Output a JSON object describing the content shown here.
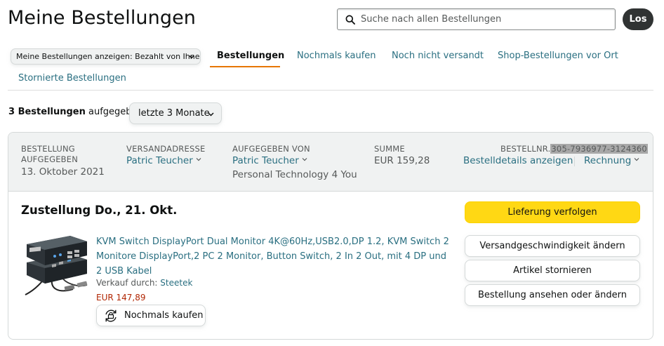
{
  "page": {
    "title": "Meine Bestellungen"
  },
  "search": {
    "placeholder": "Suche nach allen Bestellungen",
    "value": "",
    "button_label": "Los"
  },
  "filter": {
    "selected": "Meine Bestellungen anzeigen: Bezahlt von Ihnen"
  },
  "tabs": [
    {
      "label": "Bestellungen",
      "active": true
    },
    {
      "label": "Nochmals kaufen",
      "active": false
    },
    {
      "label": "Noch nicht versandt",
      "active": false
    },
    {
      "label": "Shop-Bestellungen vor Ort",
      "active": false
    },
    {
      "label": "Stornierte Bestellungen",
      "active": false
    }
  ],
  "summary": {
    "count_text": "3 Bestellungen",
    "suffix": "aufgegeben",
    "period": "letzte 3 Monate"
  },
  "order": {
    "placed_label_1": "BESTELLUNG",
    "placed_label_2": "AUFGEGEBEN",
    "placed_date": "13. Oktober 2021",
    "ship_to_label": "VERSANDADRESSE",
    "ship_to_name": "Patric Teucher",
    "placed_by_label": "AUFGEGEBEN VON",
    "placed_by_name": "Patric Teucher",
    "placed_by_company": "Personal Technology 4 You",
    "total_label": "SUMME",
    "total_value": "EUR 159,28",
    "order_number_label": "BESTELLNR.",
    "order_number": "305-7936977-3124360",
    "details_link": "Bestelldetails anzeigen",
    "invoice_link": "Rechnung",
    "delivery_status": "Zustellung Do., 21. Okt.",
    "item": {
      "title": "KVM Switch DisplayPort Dual Monitor 4K@60Hz,USB2.0,DP 1.2, KVM Switch 2 Monitore DisplayPort,2 PC 2 Monitor, Button Switch, 2 In 2 Out, mit 4 DP und 2 USB Kabel",
      "seller_label": "Verkauf durch:",
      "seller": "Steetek",
      "price": "EUR 147,89",
      "buy_again_label": "Nochmals kaufen"
    },
    "actions": {
      "track": "Lieferung verfolgen",
      "change_speed": "Versandgeschwindigkeit ändern",
      "cancel": "Artikel stornieren",
      "view_edit": "Bestellung ansehen oder ändern"
    }
  },
  "colors": {
    "accent": "#e77600",
    "link": "#2a6f81",
    "primary_button": "#ffd814",
    "price": "#b12704",
    "go_button": "#303333"
  },
  "icons": {
    "search": "magnifier-icon",
    "chevron": "chevron-down-icon",
    "buy_again": "repeat-cart-icon",
    "product": "kvm-switch-product-image"
  }
}
